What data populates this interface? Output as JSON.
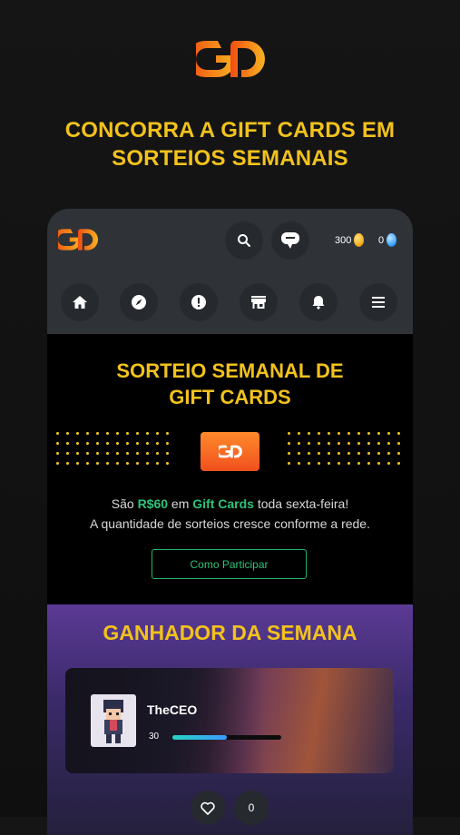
{
  "headline": {
    "line1": "CONCORRA A GIFT CARDS EM",
    "line2": "SORTEIOS SEMANAIS"
  },
  "app": {
    "header": {
      "coins_gold": "300",
      "coins_blue": "0"
    },
    "nav": [
      "home-icon",
      "compass-icon",
      "alert-icon",
      "store-icon",
      "bell-icon",
      "menu-icon"
    ],
    "promo": {
      "title_line1": "SORTEIO SEMANAL DE",
      "title_line2": "GIFT CARDS",
      "text_prefix": "São ",
      "text_amount": "R$60",
      "text_mid": " em ",
      "text_gift": "Gift Cards",
      "text_suffix": " toda sexta-feira!",
      "text_line2": "A quantidade de sorteios cresce conforme a rede.",
      "button_label": "Como Participar"
    },
    "winner": {
      "title": "GANHADOR DA SEMANA",
      "username": "TheCEO",
      "level": "30",
      "xp_progress": 0.5,
      "likes": "0"
    }
  },
  "colors": {
    "accent_yellow": "#f2c21d",
    "accent_green": "#2fc27a",
    "brand_orange": "#f0501e"
  }
}
